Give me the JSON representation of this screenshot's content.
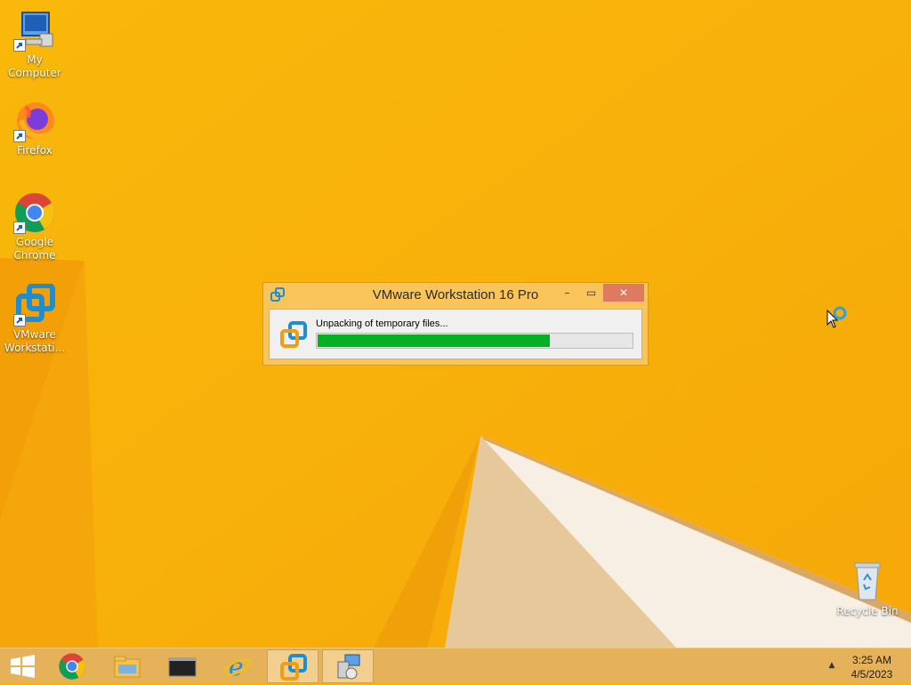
{
  "desktop": {
    "icons": [
      {
        "label": "My Computer"
      },
      {
        "label": "Firefox"
      },
      {
        "label": "Google Chrome"
      },
      {
        "label": "VMware Workstati..."
      },
      {
        "label": "Recycle Bin"
      }
    ]
  },
  "dialog": {
    "title": "VMware Workstation 16 Pro",
    "message": "Unpacking of temporary files...",
    "progress_percent": 74,
    "minimize_label": "–",
    "maximize_label": "▭",
    "close_label": "✕"
  },
  "taskbar": {
    "items": [
      "start-icon",
      "chrome-icon",
      "file-explorer-icon",
      "terminal-icon",
      "internet-explorer-icon",
      "vmware-icon",
      "installer-icon"
    ],
    "active_item": "vmware-icon",
    "tray_arrow": "▲",
    "clock": {
      "time": "3:25 AM",
      "date": "4/5/2023"
    }
  },
  "colors": {
    "wallpaper": "#f7b207",
    "progress_fill": "#06b025",
    "close_button": "#dd7a5f",
    "taskbar": "#e5b25a"
  }
}
